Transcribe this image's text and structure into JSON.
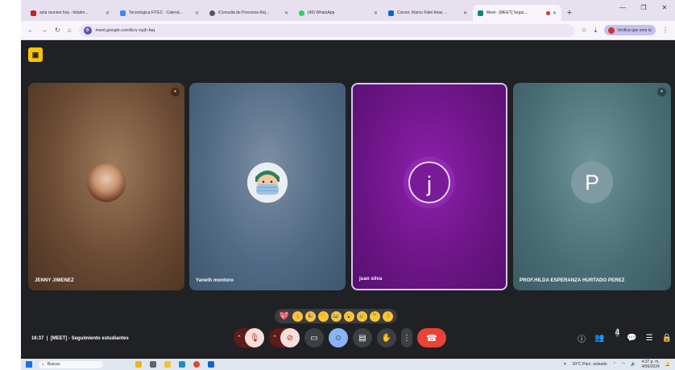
{
  "browser": {
    "tabs": [
      {
        "title": "acta reunion hoy - hidalm...",
        "color": "#c5221f",
        "active": false
      },
      {
        "title": "Tecnologica FITEC - Calend...",
        "color": "#4285f4",
        "active": false
      },
      {
        "title": "iConsulta de Procesos Rej...",
        "color": "#555555",
        "active": false
      },
      {
        "title": "(40) WhatsApp",
        "color": "#25d366",
        "active": false
      },
      {
        "title": "Correo: Marco Fidel Arias ...",
        "color": "#0a64d8",
        "active": false
      },
      {
        "title": "Meet - [MEET] Segui...",
        "color": "#00897b",
        "active": true
      }
    ],
    "newtab": "+",
    "url": "meet.google.com/bcv-nyjh-faq",
    "profile_label": "Verifica que eres tú"
  },
  "meet": {
    "participants": [
      {
        "name": "JENNY JIMENEZ",
        "avatar_type": "photo",
        "muted": true
      },
      {
        "name": "Yaneth montoro",
        "avatar_type": "illustration",
        "muted": false
      },
      {
        "name": "juan silva",
        "avatar_type": "letter",
        "initial": "j",
        "speaking": true
      },
      {
        "name": "PROF.HILDA ESPERANZA HURTADO PEREZ",
        "avatar_type": "letter",
        "initial": "P"
      }
    ],
    "meeting_time": "16:37",
    "meeting_title": "[MEET] - Seguimiento estudiantes",
    "reactions": [
      "💖",
      "👍",
      "🎉",
      "👏",
      "😂",
      "😮",
      "😢",
      "🤔",
      "👎"
    ],
    "people_count": "4"
  },
  "taskbar": {
    "search_placeholder": "Buscar",
    "weather": "20°C Parc. soleado",
    "time": "4:37 p. m.",
    "date": "4/06/2024"
  }
}
